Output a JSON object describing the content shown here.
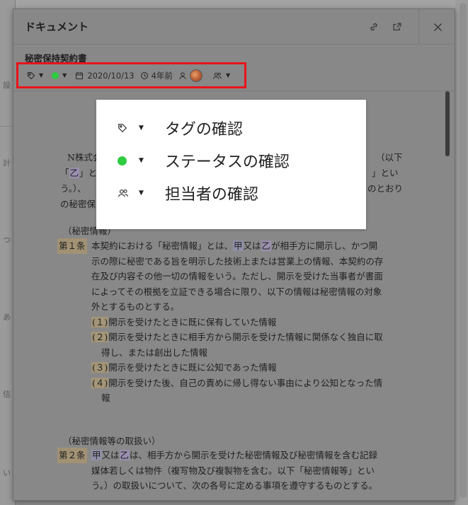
{
  "background": {
    "left_gutter_chars": [
      "設",
      "計",
      "つ",
      "あ",
      "信",
      "い"
    ]
  },
  "modal": {
    "title": "ドキュメント",
    "icons": {
      "link": "link-icon",
      "open": "external-link-icon",
      "close": "close-icon"
    }
  },
  "document": {
    "name": "秘密保持契約書",
    "meta": {
      "date": "2020/10/13",
      "relative_time": "4年前",
      "status_color": "#2ecc40"
    },
    "intro": {
      "line1": "N株式会",
      "line1_right": "（以下",
      "line2_a": "「",
      "line2_b": "乙",
      "line2_c": "」と",
      "line2_right": "」とい",
      "line3": "う。）、",
      "line3_right": "のとおり",
      "line4": "の秘密保"
    },
    "section1_title": "（秘密情報）",
    "article1": {
      "number": "第１条",
      "p1": "本契約における「秘密情報」とは、",
      "p1_a": "甲",
      "p1_mid": "又は",
      "p1_b": "乙",
      "p1_end": "が相手方に開示し、かつ開",
      "lines": [
        "示の際に秘密である旨を明示した技術上または営業上の情報、本契約の存",
        "在及び内容その他一切の情報をいう。ただし、開示を受けた当事者が書面",
        "によってその根拠を立証できる場合に限り、以下の情報は秘密情報の対象",
        "外とするものとする。"
      ],
      "items": [
        {
          "num": "(１)",
          "text": "開示を受けたときに既に保有していた情報"
        },
        {
          "num": "(２)",
          "text": "開示を受けたときに相手方から開示を受けた情報に関係なく独自に取",
          "cont": "得し、または創出した情報"
        },
        {
          "num": "(３)",
          "text": "開示を受けたときに既に公知であった情報"
        },
        {
          "num": "(４)",
          "text": "開示を受けた後、自己の責めに帰し得ない事由により公知となった情",
          "cont": "報"
        }
      ]
    },
    "section2_title": "（秘密情報等の取扱い）",
    "article2": {
      "number": "第２条",
      "p1_a": "甲",
      "p1_mid": "又は",
      "p1_b": "乙",
      "p1_end": "は、相手方から開示を受けた秘密情報及び秘密情報を含む記録",
      "lines": [
        "媒体若しくは物件（複写物及び複製物を含む。以下「秘密情報等」とい",
        "う。）の取扱いについて、次の各号に定める事項を遵守するものとする。"
      ]
    }
  },
  "callout": {
    "rows": [
      {
        "icon": "tag-icon",
        "label": "タグの確認"
      },
      {
        "icon": "status-dot-icon",
        "label": "ステータスの確認",
        "color": "#2ecc40"
      },
      {
        "icon": "assignees-icon",
        "label": "担当者の確認"
      }
    ]
  }
}
